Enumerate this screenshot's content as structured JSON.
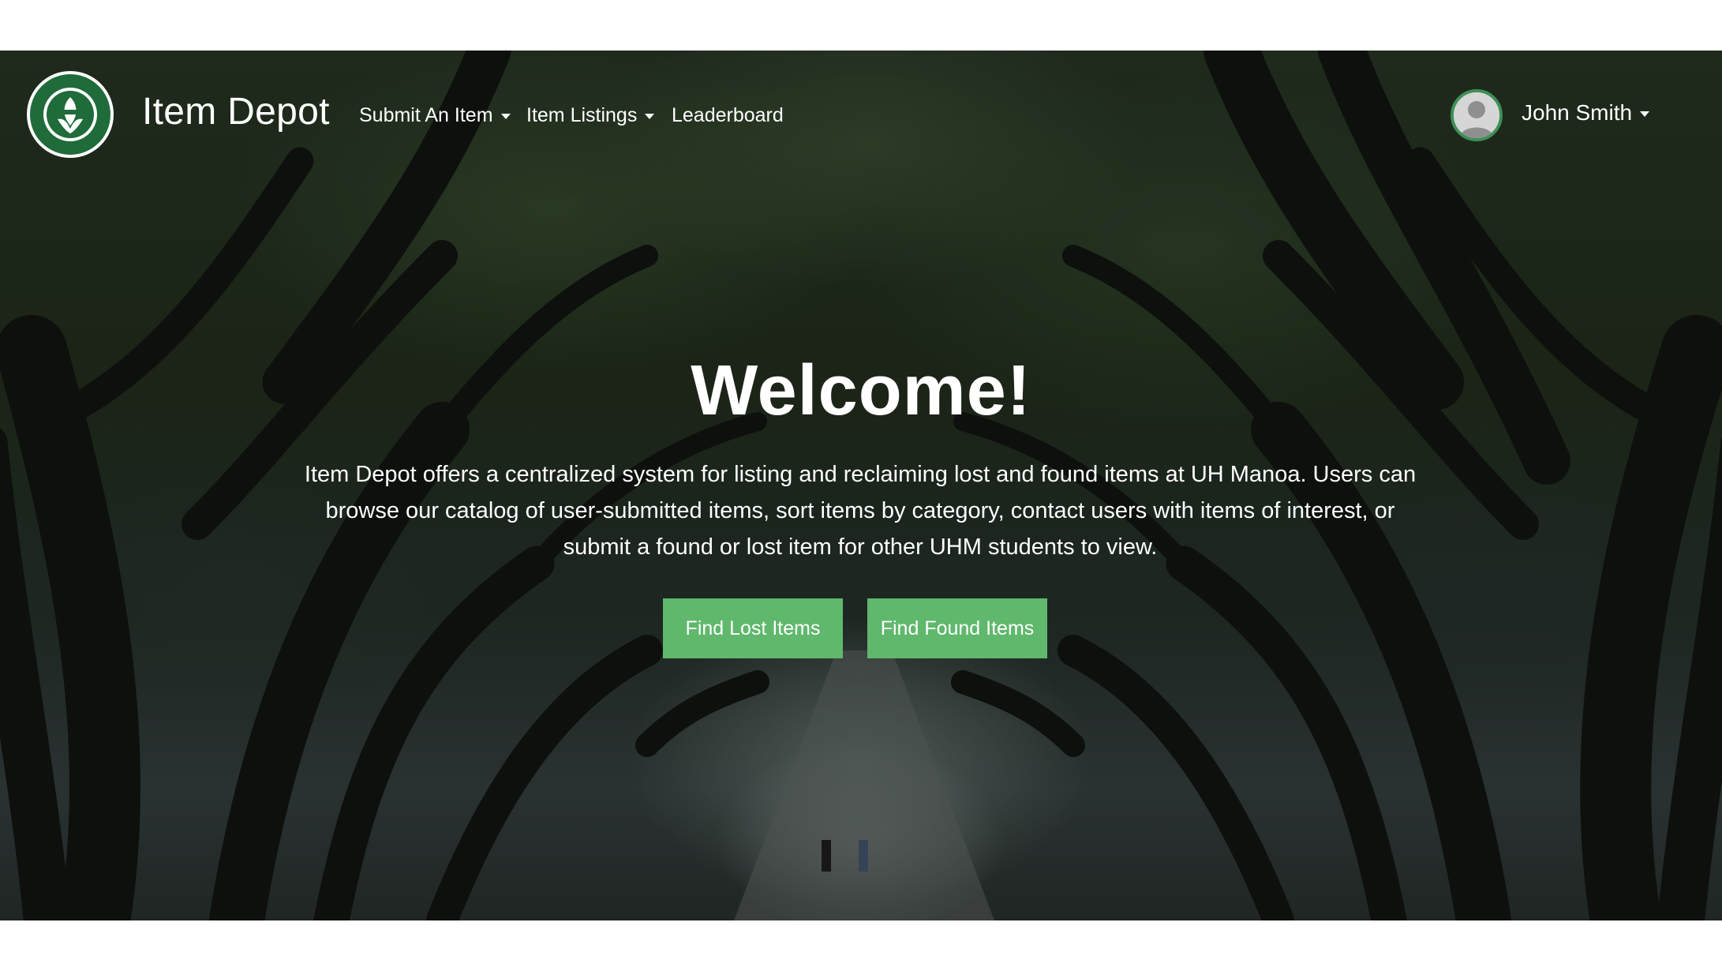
{
  "navbar": {
    "logo_icon": "university-seal-icon",
    "brand": "Item Depot",
    "items": [
      {
        "label": "Submit An Item",
        "dropdown": true
      },
      {
        "label": "Item Listings",
        "dropdown": true
      },
      {
        "label": "Leaderboard",
        "dropdown": false
      }
    ],
    "user": {
      "name": "John Smith",
      "avatar_icon": "user-avatar-icon"
    }
  },
  "hero": {
    "title": "Welcome!",
    "description": "Item Depot offers a centralized system for listing and reclaiming lost and found items at UH Manoa. Users can browse our catalog of user-submitted items, sort items by category, contact users with items of interest, or submit a found or lost item for other UHM students to view.",
    "buttons": {
      "lost": "Find Lost Items",
      "found": "Find Found Items"
    }
  },
  "colors": {
    "button": "#5fb86c",
    "avatar_border": "#3f8f56",
    "logo_green": "#1f6b3a"
  }
}
